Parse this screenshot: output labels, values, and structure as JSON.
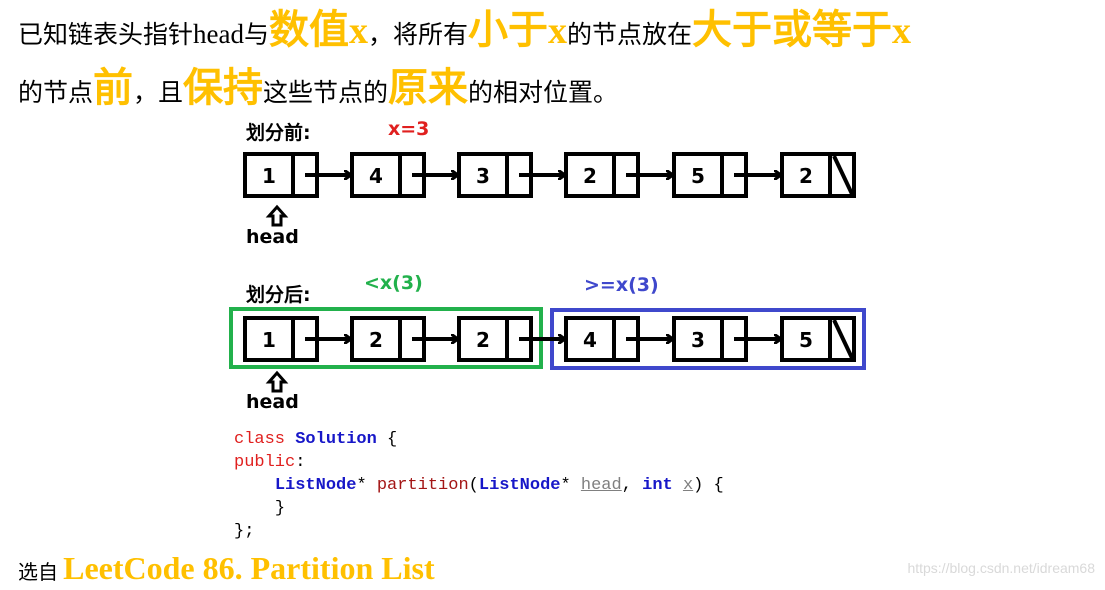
{
  "problem": {
    "line1": [
      {
        "text": "已知链表头指针",
        "style": "normal"
      },
      {
        "text": "head",
        "style": "serif"
      },
      {
        "text": "与",
        "style": "normal"
      },
      {
        "text": "数值",
        "style": "highlight"
      },
      {
        "text": "x",
        "style": "highlight-x"
      },
      {
        "text": "，将所有",
        "style": "normal"
      },
      {
        "text": "小于",
        "style": "highlight"
      },
      {
        "text": "x",
        "style": "highlight-x"
      },
      {
        "text": "的节点放在",
        "style": "normal"
      },
      {
        "text": "大于或等于",
        "style": "highlight"
      },
      {
        "text": "x",
        "style": "highlight-x"
      }
    ],
    "line2": [
      {
        "text": "的节点",
        "style": "normal"
      },
      {
        "text": "前",
        "style": "highlight"
      },
      {
        "text": "，且",
        "style": "normal"
      },
      {
        "text": "保持",
        "style": "highlight"
      },
      {
        "text": "这些节点的",
        "style": "normal"
      },
      {
        "text": "原来",
        "style": "highlight"
      },
      {
        "text": "的相对位置。",
        "style": "normal"
      }
    ]
  },
  "before": {
    "label": "划分前:",
    "x_label": "x=3",
    "nodes": [
      "1",
      "4",
      "3",
      "2",
      "5",
      "2"
    ],
    "head_label": "head"
  },
  "after": {
    "label": "划分后:",
    "less_label": "<x(3)",
    "geq_label": ">=x(3)",
    "nodes": [
      "1",
      "2",
      "2",
      "4",
      "3",
      "5"
    ],
    "less_count": 3,
    "head_label": "head"
  },
  "code": {
    "line1": {
      "kw": "class",
      "name": "Solution",
      "brace": " {"
    },
    "line2": {
      "kw": "public",
      "colon": ":"
    },
    "line3": {
      "ret": "ListNode",
      "star1": "* ",
      "fn": "partition",
      "open": "(",
      "type1": "ListNode",
      "star2": "* ",
      "p1": "head",
      "comma": ", ",
      "type2": "int",
      "sp": " ",
      "p2": "x",
      "close": ") {"
    },
    "line4": "}",
    "line5": "};"
  },
  "footer": {
    "prefix": "选自",
    "title": "LeetCode 86. Partition List"
  },
  "watermark": "https://blog.csdn.net/idream68",
  "colors": {
    "highlight": "#ffc000",
    "x_label": "#e0201f",
    "less_group": "#22b14c",
    "geq_group": "#3f48cc"
  }
}
